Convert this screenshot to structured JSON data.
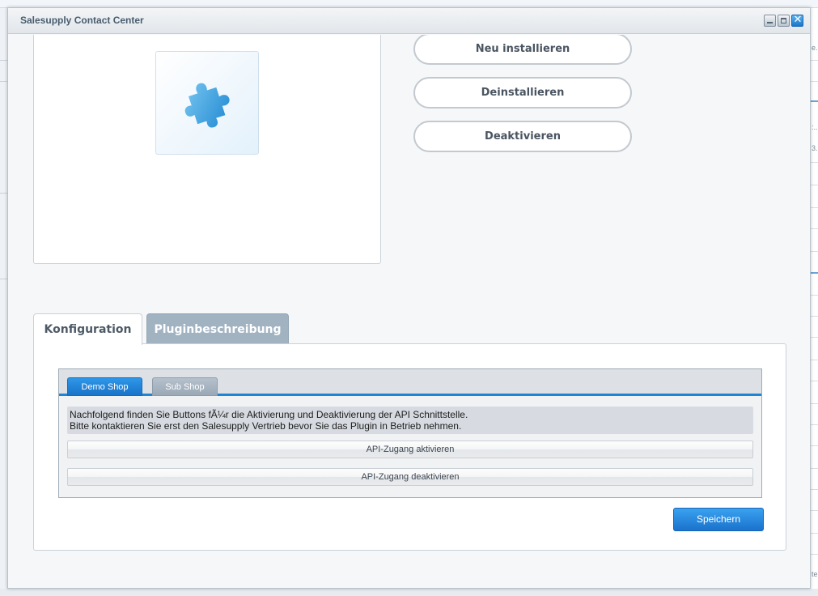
{
  "window": {
    "title": "Salesupply Contact Center",
    "controls": {
      "minimize": "minimize-icon",
      "maximize": "maximize-icon",
      "close": "✕"
    }
  },
  "plugin": {
    "icon": "puzzle-piece-icon",
    "icon_color": "#3aa7e6"
  },
  "actions": {
    "reinstall": "Neu installieren",
    "uninstall": "Deinstallieren",
    "deactivate": "Deaktivieren"
  },
  "tabs": [
    {
      "label": "Konfiguration",
      "active": true
    },
    {
      "label": "Pluginbeschreibung",
      "active": false
    }
  ],
  "config": {
    "shop_tabs": [
      {
        "label": "Demo Shop",
        "active": true
      },
      {
        "label": "Sub Shop",
        "active": false
      }
    ],
    "info_lines": [
      "Nachfolgend finden Sie Buttons fÃ¼r die Aktivierung und Deaktivierung der API Schnittstelle.",
      "Bitte kontaktieren Sie erst den Salesupply Vertrieb bevor Sie das Plugin in Betrieb nehmen."
    ],
    "activate_label": "API-Zugang aktivieren",
    "deactivate_label": "API-Zugang deaktivieren",
    "save_label": "Speichern"
  },
  "background": {
    "right_fragments": [
      "e.",
      ":..",
      "3..",
      "te"
    ]
  },
  "colors": {
    "accent": "#1e84d6",
    "inactive_tab": "#a1b2c1"
  }
}
